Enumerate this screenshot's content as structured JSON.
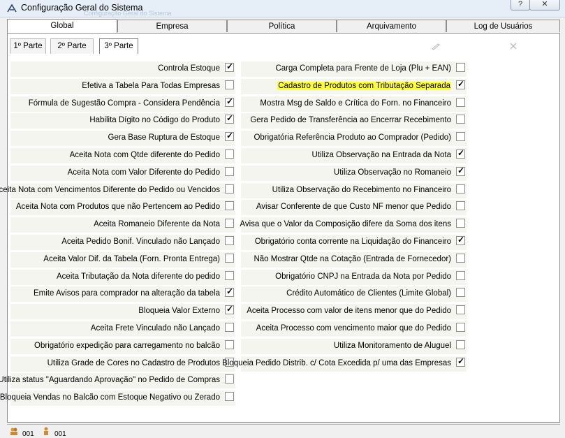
{
  "window": {
    "title": "Configuração Geral do Sistema",
    "ghost_title": "Configuração Geral do Sistema",
    "help_label": "?",
    "close_label": "✕"
  },
  "tabs": [
    "Global",
    "Empresa",
    "Política",
    "Arquivamento",
    "Log de Usuários"
  ],
  "subtabs": [
    "1º Parte",
    "2º Parte",
    "3º Parte"
  ],
  "toolbar": {
    "edit_icon": "pencil-icon",
    "clear_icon": "eraser-x-icon"
  },
  "left_options": [
    {
      "label": "Controla Estoque",
      "checked": true
    },
    {
      "label": "Efetiva a Tabela Para Todas Empresas",
      "checked": false
    },
    {
      "label": "Fórmula de Sugestão Compra - Considera Pendência",
      "checked": true
    },
    {
      "label": "Habilita Dígito no Código do Produto",
      "checked": true
    },
    {
      "label": "Gera Base Ruptura de Estoque",
      "checked": true
    },
    {
      "label": "Aceita Nota com Qtde diferente do Pedido",
      "checked": false
    },
    {
      "label": "Aceita Nota com Valor Diferente do Pedido",
      "checked": false
    },
    {
      "label": "Aceita Nota com Vencimentos Diferente do Pedido ou Vencidos",
      "checked": false
    },
    {
      "label": "Aceita Nota com Produtos que não Pertencem ao Pedido",
      "checked": false
    },
    {
      "label": "Aceita Romaneio Diferente da Nota",
      "checked": false
    },
    {
      "label": "Aceita Pedido Bonif. Vinculado não Lançado",
      "checked": false
    },
    {
      "label": "Aceita Valor Dif. da Tabela (Forn. Pronta Entrega)",
      "checked": false
    },
    {
      "label": "Aceita Tributação da Nota diferente do pedido",
      "checked": false
    },
    {
      "label": "Emite Avisos para comprador na alteração da tabela",
      "checked": true
    },
    {
      "label": "Bloqueia Valor Externo",
      "checked": true
    },
    {
      "label": "Aceita Frete Vinculado não Lançado",
      "checked": false
    },
    {
      "label": "Obrigatório expedição para carregamento no balcão",
      "checked": false
    },
    {
      "label": "Utiliza Grade de Cores no Cadastro de Produtos",
      "checked": false
    },
    {
      "label": "Utiliza status \"Aguardando Aprovação\" no Pedido de Compras",
      "checked": false
    },
    {
      "label": "Bloqueia Vendas no Balcão com Estoque Negativo ou Zerado",
      "checked": false
    }
  ],
  "right_options": [
    {
      "label": "Carga Completa para Frente de Loja (Plu + EAN)",
      "checked": false,
      "highlight": false
    },
    {
      "label": "Cadastro de Produtos com Tributação Separada",
      "checked": true,
      "highlight": true
    },
    {
      "label": "Mostra Msg de Saldo e Crítica do Forn. no Financeiro",
      "checked": false,
      "highlight": false
    },
    {
      "label": "Gera Pedido de Transferência ao Encerrar Recebimento",
      "checked": false,
      "highlight": false
    },
    {
      "label": "Obrigatória Referência Produto ao Comprador (Pedido)",
      "checked": false,
      "highlight": false
    },
    {
      "label": "Utiliza Observação na Entrada da Nota",
      "checked": true,
      "highlight": false
    },
    {
      "label": "Utiliza Observação no Romaneio",
      "checked": true,
      "highlight": false
    },
    {
      "label": "Utiliza Observação do Recebimento no Financeiro",
      "checked": false,
      "highlight": false
    },
    {
      "label": "Avisar Conferente de que Custo NF menor que Pedido",
      "checked": false,
      "highlight": false
    },
    {
      "label": "Avisa que o Valor da Composição difere da Soma dos itens",
      "checked": false,
      "highlight": false
    },
    {
      "label": "Obrigatório conta corrente na Liquidação do Financeiro",
      "checked": true,
      "highlight": false
    },
    {
      "label": "Não Mostrar Qtde na Cotação (Entrada de Fornecedor)",
      "checked": false,
      "highlight": false
    },
    {
      "label": "Obrigatório CNPJ na Entrada da Nota por Pedido",
      "checked": false,
      "highlight": false
    },
    {
      "label": "Crédito Automático de Clientes (Limite Global)",
      "checked": false,
      "highlight": false
    },
    {
      "label": "Aceita Processo com valor de itens menor que do Pedido",
      "checked": false,
      "highlight": false
    },
    {
      "label": "Aceita Processo com vencimento maior que do Pedido",
      "checked": false,
      "highlight": false
    },
    {
      "label": "Utiliza Monitoramento de Aluguel",
      "checked": false,
      "highlight": false
    },
    {
      "label": "Bloqueia Pedido Distrib. c/ Cota Excedida p/ uma das Empresas",
      "checked": true,
      "highlight": false
    }
  ],
  "status": {
    "item1": "001",
    "item2": "001"
  }
}
